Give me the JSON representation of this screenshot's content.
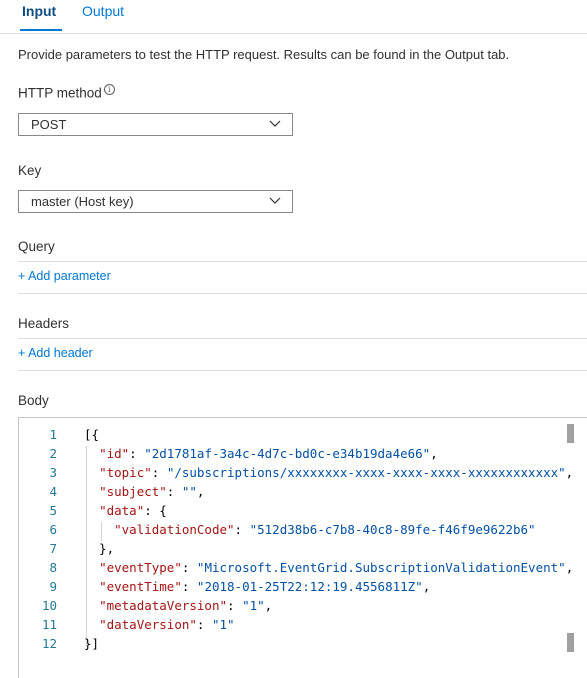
{
  "tabs": [
    {
      "label": "Input",
      "active": true
    },
    {
      "label": "Output",
      "active": false
    }
  ],
  "description": "Provide parameters to test the HTTP request. Results can be found in the Output tab.",
  "http_method": {
    "label": "HTTP method",
    "info_icon": "info-icon",
    "value": "POST"
  },
  "key": {
    "label": "Key",
    "value": "master (Host key)"
  },
  "query": {
    "label": "Query",
    "add_label": "+ Add parameter"
  },
  "headers": {
    "label": "Headers",
    "add_label": "+ Add header"
  },
  "body": {
    "label": "Body",
    "line_numbers": [
      "1",
      "2",
      "3",
      "4",
      "5",
      "6",
      "7",
      "8",
      "9",
      "10",
      "11",
      "12"
    ],
    "lines": [
      [
        {
          "t": "[{",
          "c": "p"
        }
      ],
      [
        {
          "t": "  ",
          "c": "p"
        },
        {
          "t": "\"id\"",
          "c": "k"
        },
        {
          "t": ": ",
          "c": "p"
        },
        {
          "t": "\"2d1781af-3a4c-4d7c-bd0c-e34b19da4e66\"",
          "c": "v"
        },
        {
          "t": ",",
          "c": "p"
        }
      ],
      [
        {
          "t": "  ",
          "c": "p"
        },
        {
          "t": "\"topic\"",
          "c": "k"
        },
        {
          "t": ": ",
          "c": "p"
        },
        {
          "t": "\"/subscriptions/xxxxxxxx-xxxx-xxxx-xxxx-xxxxxxxxxxxx\"",
          "c": "v"
        },
        {
          "t": ",",
          "c": "p"
        }
      ],
      [
        {
          "t": "  ",
          "c": "p"
        },
        {
          "t": "\"subject\"",
          "c": "k"
        },
        {
          "t": ": ",
          "c": "p"
        },
        {
          "t": "\"\"",
          "c": "v"
        },
        {
          "t": ",",
          "c": "p"
        }
      ],
      [
        {
          "t": "  ",
          "c": "p"
        },
        {
          "t": "\"data\"",
          "c": "k"
        },
        {
          "t": ": {",
          "c": "p"
        }
      ],
      [
        {
          "t": "    ",
          "c": "p"
        },
        {
          "t": "\"validationCode\"",
          "c": "k"
        },
        {
          "t": ": ",
          "c": "p"
        },
        {
          "t": "\"512d38b6-c7b8-40c8-89fe-f46f9e9622b6\"",
          "c": "v"
        }
      ],
      [
        {
          "t": "  },",
          "c": "p"
        }
      ],
      [
        {
          "t": "  ",
          "c": "p"
        },
        {
          "t": "\"eventType\"",
          "c": "k"
        },
        {
          "t": ": ",
          "c": "p"
        },
        {
          "t": "\"Microsoft.EventGrid.SubscriptionValidationEvent\"",
          "c": "v"
        },
        {
          "t": ",",
          "c": "p"
        }
      ],
      [
        {
          "t": "  ",
          "c": "p"
        },
        {
          "t": "\"eventTime\"",
          "c": "k"
        },
        {
          "t": ": ",
          "c": "p"
        },
        {
          "t": "\"2018-01-25T22:12:19.4556811Z\"",
          "c": "v"
        },
        {
          "t": ",",
          "c": "p"
        }
      ],
      [
        {
          "t": "  ",
          "c": "p"
        },
        {
          "t": "\"metadataVersion\"",
          "c": "k"
        },
        {
          "t": ": ",
          "c": "p"
        },
        {
          "t": "\"1\"",
          "c": "v"
        },
        {
          "t": ",",
          "c": "p"
        }
      ],
      [
        {
          "t": "  ",
          "c": "p"
        },
        {
          "t": "\"dataVersion\"",
          "c": "k"
        },
        {
          "t": ": ",
          "c": "p"
        },
        {
          "t": "\"1\"",
          "c": "v"
        }
      ],
      [
        {
          "t": "}]",
          "c": "p"
        }
      ]
    ]
  },
  "colors": {
    "accent": "#0078d4",
    "json_key": "#a31515",
    "json_value": "#0451a5",
    "line_number": "#237893"
  }
}
